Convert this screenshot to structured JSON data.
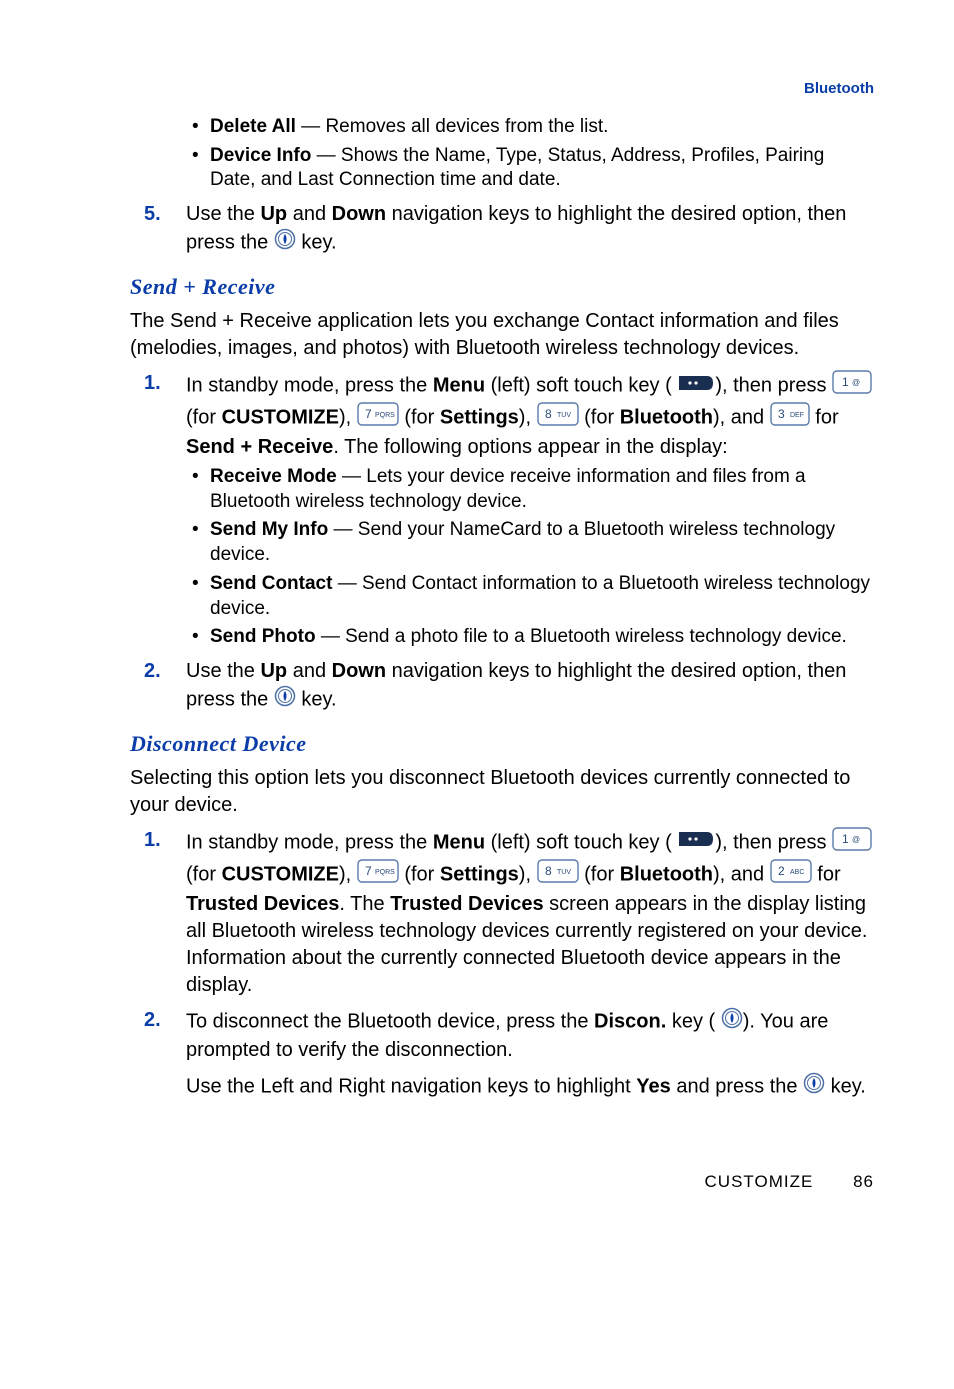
{
  "header": {
    "label": "Bluetooth"
  },
  "topBullets": [
    {
      "bold": "Delete All",
      "rest": " — Removes all devices from the list."
    },
    {
      "bold": "Device Info",
      "rest": " — Shows the Name, Type, Status, Address, Profiles, Pairing Date, and Last Connection time and date."
    }
  ],
  "topStep": {
    "num": "5.",
    "pre": "Use the ",
    "b1": "Up",
    "mid": " and ",
    "b2": "Down",
    "post1": " navigation keys to highlight the desired option, then press the ",
    "post2": " key."
  },
  "section1": {
    "heading": "Send + Receive",
    "intro": "The Send + Receive application lets you exchange Contact information and files (melodies, images, and photos) with Bluetooth wireless technology devices.",
    "step1": {
      "num": "1.",
      "p1a": "In standby mode, press the ",
      "p1b": "Menu",
      "p1c": " (left) soft touch key (",
      "p1d": "), then press ",
      "for_customize_l": " (for ",
      "for_customize_b": "CUSTOMIZE",
      "for_customize_r": "), ",
      "for_settings_l": " (for ",
      "for_settings_b": "Settings",
      "for_settings_r": "), ",
      "for_bt_l": " (for ",
      "for_bt_b": "Bluetooth",
      "for_bt_r": "), and ",
      "for_sr_l": " for ",
      "for_sr_b": "Send + Receive",
      "for_sr_r": ". The following options appear in the display:"
    },
    "bullets": [
      {
        "bold": "Receive Mode",
        "rest": " — Lets your device receive information and files from a Bluetooth wireless technology device."
      },
      {
        "bold": "Send My Info",
        "rest": " — Send your NameCard to a Bluetooth wireless technology device."
      },
      {
        "bold": "Send Contact",
        "rest": " — Send Contact information to a Bluetooth wireless technology device."
      },
      {
        "bold": "Send Photo",
        "rest": " — Send a photo file to a Bluetooth wireless technology device."
      }
    ],
    "step2": {
      "num": "2.",
      "pre": "Use the ",
      "b1": "Up",
      "mid": " and ",
      "b2": "Down",
      "post1": " navigation keys to highlight the desired option, then press the ",
      "post2": " key."
    }
  },
  "section2": {
    "heading": "Disconnect Device",
    "intro": "Selecting this option lets you disconnect Bluetooth devices currently connected to your device.",
    "step1": {
      "num": "1.",
      "p1a": "In standby mode, press the ",
      "p1b": "Menu",
      "p1c": " (left) soft touch key (",
      "p1d": "), then press ",
      "for_customize_l": " (for ",
      "for_customize_b": "CUSTOMIZE",
      "for_customize_r": "), ",
      "for_settings_l": " (for ",
      "for_settings_b": "Settings",
      "for_settings_r": "), ",
      "for_bt_l": " (for ",
      "for_bt_b": "Bluetooth",
      "for_bt_r": "), and ",
      "for_td_l": " for ",
      "for_td_b": "Trusted Devices",
      "for_td_mid": ". The ",
      "for_td_b2": "Trusted Devices",
      "for_td_rest": " screen appears in the display listing all Bluetooth wireless technology devices currently registered on your device. Information about the currently connected Bluetooth device appears in the display."
    },
    "step2": {
      "num": "2.",
      "pre": "To disconnect the Bluetooth device, press the ",
      "b1": "Discon.",
      "mid": " key (",
      "post1": "). You are prompted to verify the disconnection.",
      "line2a": "Use the Left and Right navigation keys to highlight ",
      "line2b": "Yes",
      "line2c": " and press the ",
      "line2d": " key."
    }
  },
  "footer": {
    "text": "CUSTOMIZE",
    "page": "86"
  }
}
